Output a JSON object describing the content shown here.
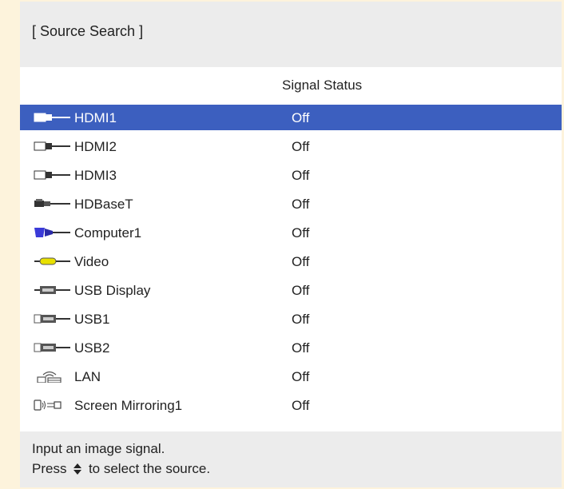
{
  "header": {
    "title": "[ Source Search ]"
  },
  "list": {
    "column_header": "Signal Status",
    "selected_index": 0,
    "sources": [
      {
        "label": "HDMI1",
        "status": "Off",
        "icon": "hdmi-connector-icon"
      },
      {
        "label": "HDMI2",
        "status": "Off",
        "icon": "hdmi-connector-icon"
      },
      {
        "label": "HDMI3",
        "status": "Off",
        "icon": "hdmi-connector-icon"
      },
      {
        "label": "HDBaseT",
        "status": "Off",
        "icon": "hdbaset-connector-icon"
      },
      {
        "label": "Computer1",
        "status": "Off",
        "icon": "vga-connector-icon"
      },
      {
        "label": "Video",
        "status": "Off",
        "icon": "rca-video-connector-icon"
      },
      {
        "label": "USB Display",
        "status": "Off",
        "icon": "usb-display-connector-icon"
      },
      {
        "label": "USB1",
        "status": "Off",
        "icon": "usb-connector-icon"
      },
      {
        "label": "USB2",
        "status": "Off",
        "icon": "usb-connector-icon"
      },
      {
        "label": "LAN",
        "status": "Off",
        "icon": "lan-network-icon"
      },
      {
        "label": "Screen Mirroring1",
        "status": "Off",
        "icon": "screen-mirroring-icon"
      }
    ]
  },
  "footer": {
    "line1": "Input an image signal.",
    "line2_prefix": "Press",
    "line2_suffix": "to select the source."
  },
  "colors": {
    "selected_row": "#3c5fbf",
    "panel_bg": "#ececec",
    "list_bg": "#ffffff",
    "page_bg": "#fdf3dc",
    "vga_blue": "#3a3ad8",
    "video_yellow": "#e8e000"
  }
}
